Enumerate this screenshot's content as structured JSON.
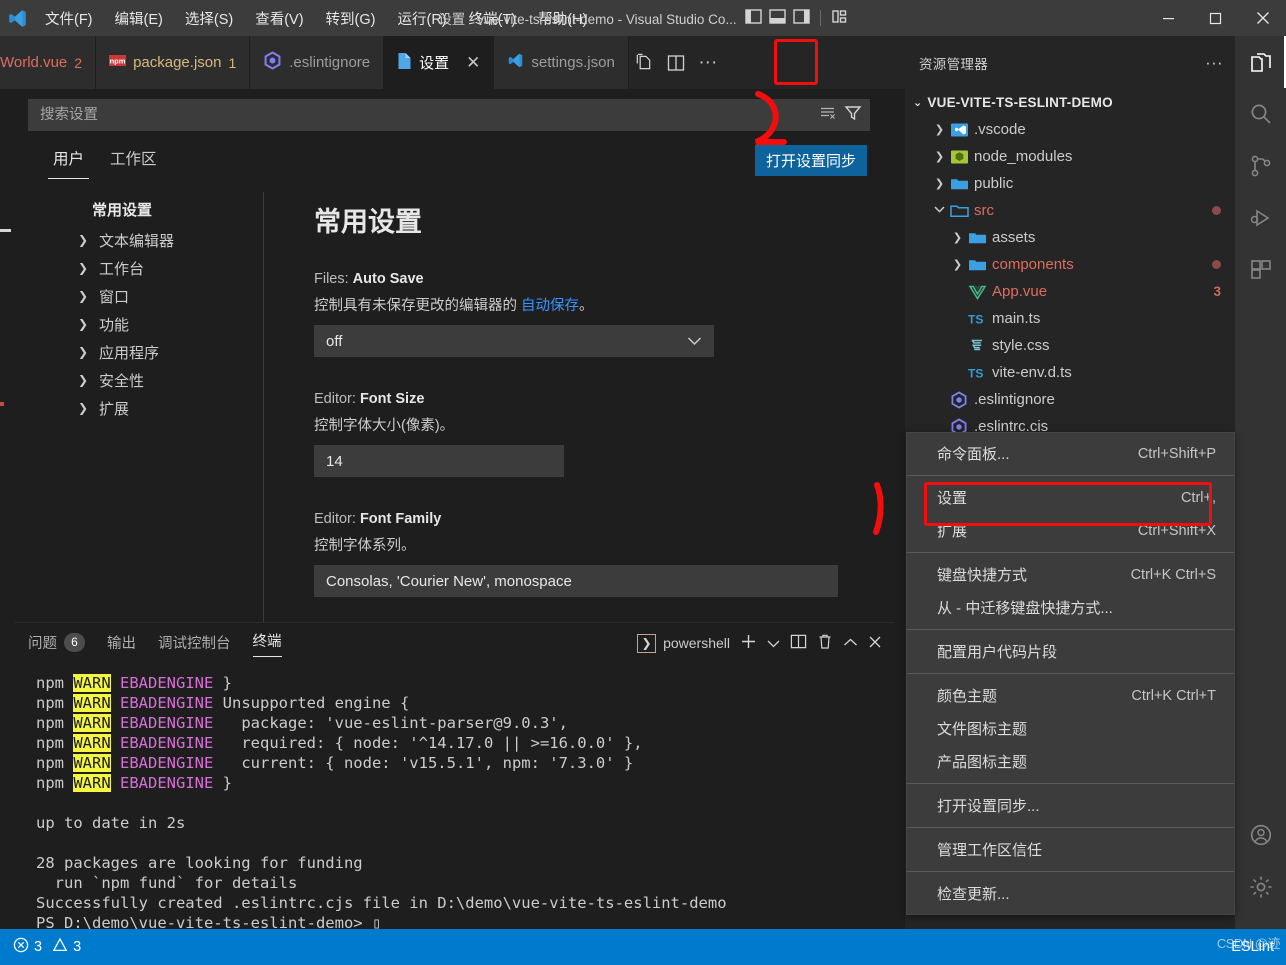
{
  "window": {
    "title": "设置 - vue-vite-ts-eslint-demo - Visual Studio Co...",
    "menus": [
      "文件(F)",
      "编辑(E)",
      "选择(S)",
      "查看(V)",
      "转到(G)",
      "运行(R)",
      "终端(T)",
      "帮助(H)"
    ],
    "layout_icons": [
      "toggle-primary-sidebar-icon",
      "toggle-panel-icon",
      "toggle-secondary-sidebar-icon",
      "customize-layout-icon"
    ],
    "controls": [
      "minimize",
      "maximize",
      "close"
    ]
  },
  "tabs": [
    {
      "label": "World.vue",
      "badge": "2",
      "icon": "vue-icon",
      "active": false,
      "truncated": true
    },
    {
      "label": "package.json",
      "badge": "1",
      "icon": "npm-icon",
      "active": false
    },
    {
      "label": ".eslintignore",
      "badge": "",
      "icon": "eslint-icon",
      "active": false
    },
    {
      "label": "设置",
      "badge": "",
      "icon": "settings-file-icon",
      "active": true,
      "closeable": true
    },
    {
      "label": "settings.json",
      "badge": "",
      "icon": "vscode-icon",
      "active": false
    }
  ],
  "tab_actions": [
    "open-changes-icon",
    "split-editor-icon",
    "more-actions-icon"
  ],
  "settings": {
    "search_placeholder": "搜索设置",
    "search_value": "",
    "search_icons": [
      "clear-filters-icon",
      "filter-icon"
    ],
    "scope_tabs": [
      {
        "label": "用户",
        "active": true
      },
      {
        "label": "工作区",
        "active": false
      }
    ],
    "sync_button": "打开设置同步",
    "tree_title": "常用设置",
    "tree_items": [
      "文本编辑器",
      "工作台",
      "窗口",
      "功能",
      "应用程序",
      "安全性",
      "扩展"
    ],
    "heading": "常用设置",
    "items": [
      {
        "key_prefix": "Files: ",
        "key_name": "Auto Save",
        "desc_before": "控制具有未保存更改的编辑器的 ",
        "desc_link": "自动保存",
        "desc_after": "。",
        "control": "select",
        "value": "off"
      },
      {
        "key_prefix": "Editor: ",
        "key_name": "Font Size",
        "desc_before": "控制字体大小(像素)。",
        "desc_link": "",
        "desc_after": "",
        "control": "input",
        "value": "14"
      },
      {
        "key_prefix": "Editor: ",
        "key_name": "Font Family",
        "desc_before": "控制字体系列。",
        "desc_link": "",
        "desc_after": "",
        "control": "input-wide",
        "value": "Consolas, 'Courier New', monospace"
      }
    ]
  },
  "explorer": {
    "title": "资源管理器",
    "more_icon": "more-actions-icon",
    "root": "VUE-VITE-TS-ESLINT-DEMO",
    "rows": [
      {
        "label": ".vscode",
        "indent": 1,
        "chev": "collapsed",
        "icon": "vscode-folder-icon",
        "color": "normal",
        "suffix": ""
      },
      {
        "label": "node_modules",
        "indent": 1,
        "chev": "collapsed",
        "icon": "node-folder-icon",
        "color": "normal",
        "suffix": ""
      },
      {
        "label": "public",
        "indent": 1,
        "chev": "collapsed",
        "icon": "folder-icon",
        "color": "normal",
        "suffix": ""
      },
      {
        "label": "src",
        "indent": 1,
        "chev": "expanded",
        "icon": "folder-open-icon",
        "color": "modified",
        "suffix": "dot"
      },
      {
        "label": "assets",
        "indent": 2,
        "chev": "collapsed",
        "icon": "folder-icon",
        "color": "normal",
        "suffix": ""
      },
      {
        "label": "components",
        "indent": 2,
        "chev": "collapsed",
        "icon": "folder-icon",
        "color": "modified",
        "suffix": "dot"
      },
      {
        "label": "App.vue",
        "indent": 2,
        "chev": "none",
        "icon": "vue-icon",
        "color": "modified",
        "suffix": "count",
        "count": "3"
      },
      {
        "label": "main.ts",
        "indent": 2,
        "chev": "none",
        "icon": "ts-icon",
        "color": "normal",
        "suffix": ""
      },
      {
        "label": "style.css",
        "indent": 2,
        "chev": "none",
        "icon": "css-icon",
        "color": "normal",
        "suffix": ""
      },
      {
        "label": "vite-env.d.ts",
        "indent": 2,
        "chev": "none",
        "icon": "ts-icon",
        "color": "normal",
        "suffix": ""
      },
      {
        "label": ".eslintignore",
        "indent": 1,
        "chev": "none",
        "icon": "eslint-icon",
        "color": "normal",
        "suffix": ""
      },
      {
        "label": ".eslintrc.cis",
        "indent": 1,
        "chev": "none",
        "icon": "eslint-icon",
        "color": "normal",
        "suffix": ""
      }
    ]
  },
  "activity_bar": {
    "top_icons": [
      "explorer-icon",
      "search-icon",
      "source-control-icon",
      "run-and-debug-icon",
      "extensions-icon"
    ],
    "bottom_icons": [
      "accounts-icon",
      "manage-gear-icon"
    ]
  },
  "context_menu": {
    "groups": [
      [
        {
          "label": "命令面板...",
          "key": "Ctrl+Shift+P"
        }
      ],
      [
        {
          "label": "设置",
          "key": "Ctrl+,",
          "highlighted": true
        },
        {
          "label": "扩展",
          "key": "Ctrl+Shift+X"
        }
      ],
      [
        {
          "label": "键盘快捷方式",
          "key": "Ctrl+K Ctrl+S"
        },
        {
          "label": "从 - 中迁移键盘快捷方式...",
          "key": ""
        }
      ],
      [
        {
          "label": "配置用户代码片段",
          "key": ""
        }
      ],
      [
        {
          "label": "颜色主题",
          "key": "Ctrl+K Ctrl+T"
        },
        {
          "label": "文件图标主题",
          "key": ""
        },
        {
          "label": "产品图标主题",
          "key": ""
        }
      ],
      [
        {
          "label": "打开设置同步...",
          "key": ""
        }
      ],
      [
        {
          "label": "管理工作区信任",
          "key": ""
        }
      ],
      [
        {
          "label": "检查更新...",
          "key": ""
        }
      ]
    ]
  },
  "panel": {
    "tabs": [
      {
        "label": "问题",
        "badge": "6",
        "active": false
      },
      {
        "label": "输出",
        "badge": "",
        "active": false
      },
      {
        "label": "调试控制台",
        "badge": "",
        "active": false
      },
      {
        "label": "终端",
        "badge": "",
        "active": true
      }
    ],
    "shell": "powershell",
    "actions": [
      "new-terminal-icon",
      "chevron-down-icon",
      "split-terminal-icon",
      "kill-terminal-icon",
      "maximize-panel-icon",
      "close-panel-icon"
    ],
    "terminal_lines": [
      [
        {
          "t": "npm ",
          "c": "n"
        },
        {
          "t": "WARN",
          "c": "w"
        },
        {
          "t": " ",
          "c": "n"
        },
        {
          "t": "EBADENGINE",
          "c": "m"
        },
        {
          "t": " }",
          "c": "n"
        }
      ],
      [
        {
          "t": "npm ",
          "c": "n"
        },
        {
          "t": "WARN",
          "c": "w"
        },
        {
          "t": " ",
          "c": "n"
        },
        {
          "t": "EBADENGINE",
          "c": "m"
        },
        {
          "t": " Unsupported engine {",
          "c": "n"
        }
      ],
      [
        {
          "t": "npm ",
          "c": "n"
        },
        {
          "t": "WARN",
          "c": "w"
        },
        {
          "t": " ",
          "c": "n"
        },
        {
          "t": "EBADENGINE",
          "c": "m"
        },
        {
          "t": "   package: 'vue-eslint-parser@9.0.3',",
          "c": "n"
        }
      ],
      [
        {
          "t": "npm ",
          "c": "n"
        },
        {
          "t": "WARN",
          "c": "w"
        },
        {
          "t": " ",
          "c": "n"
        },
        {
          "t": "EBADENGINE",
          "c": "m"
        },
        {
          "t": "   required: { node: '^14.17.0 || >=16.0.0' },",
          "c": "n"
        }
      ],
      [
        {
          "t": "npm ",
          "c": "n"
        },
        {
          "t": "WARN",
          "c": "w"
        },
        {
          "t": " ",
          "c": "n"
        },
        {
          "t": "EBADENGINE",
          "c": "m"
        },
        {
          "t": "   current: { node: 'v15.5.1', npm: '7.3.0' }",
          "c": "n"
        }
      ],
      [
        {
          "t": "npm ",
          "c": "n"
        },
        {
          "t": "WARN",
          "c": "w"
        },
        {
          "t": " ",
          "c": "n"
        },
        {
          "t": "EBADENGINE",
          "c": "m"
        },
        {
          "t": " }",
          "c": "n"
        }
      ],
      [
        {
          "t": "",
          "c": "n"
        }
      ],
      [
        {
          "t": "up to date in 2s",
          "c": "n"
        }
      ],
      [
        {
          "t": "",
          "c": "n"
        }
      ],
      [
        {
          "t": "28 packages are looking for funding",
          "c": "n"
        }
      ],
      [
        {
          "t": "  run `npm fund` for details",
          "c": "n"
        }
      ],
      [
        {
          "t": "Successfully created .eslintrc.cjs file in D:\\demo\\vue-vite-ts-eslint-demo",
          "c": "n"
        }
      ],
      [
        {
          "t": "PS D:\\demo\\vue-vite-ts-eslint-demo> ",
          "c": "n"
        },
        {
          "t": "▯",
          "c": "n"
        }
      ]
    ]
  },
  "status_bar": {
    "errors": "3",
    "warnings": "3",
    "right_label": "ESLint",
    "watermark": "CSDN @迹"
  },
  "colors": {
    "accent": "#007acc",
    "annotation_red": "#f40d0d",
    "link": "#3794ff",
    "sync_button": "#0e639c",
    "warn_bg": "#f5f543",
    "magenta": "#d670d6",
    "modified_file": "#e06c5d"
  }
}
